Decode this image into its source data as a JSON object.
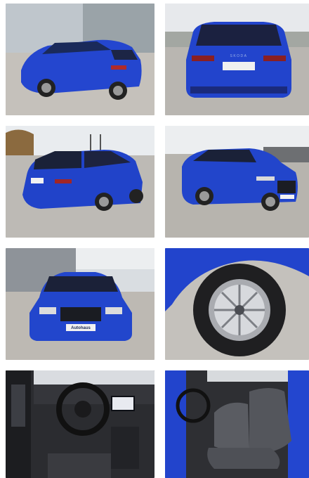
{
  "gallery": {
    "photos": [
      {
        "id": "rear-quarter-left"
      },
      {
        "id": "rear-view"
      },
      {
        "id": "rear-quarter-left-lot"
      },
      {
        "id": "front-quarter-left"
      },
      {
        "id": "front-view-dealer"
      },
      {
        "id": "wheel-closeup"
      },
      {
        "id": "cockpit-interior"
      },
      {
        "id": "front-seats-interior"
      }
    ]
  },
  "colors": {
    "car_body": "#2143c9",
    "car_dark": "#132a85",
    "sky": "#dfe3e8",
    "ground": "#c9c6c1",
    "interior": "#2b2c30"
  },
  "text": {
    "rear_badge": "SKODA",
    "front_plate": "Autohaus"
  }
}
